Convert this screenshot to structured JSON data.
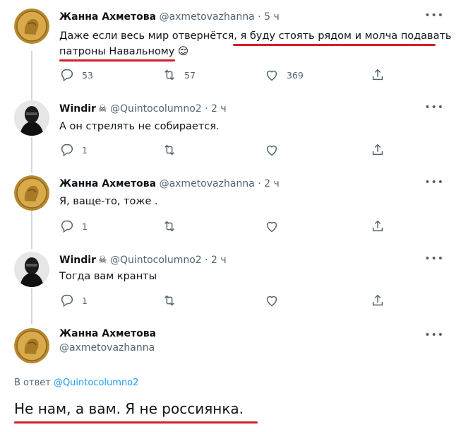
{
  "tweets": [
    {
      "name": "Жанна Ахметова",
      "handle": "@axmetovazhanna",
      "sep": "·",
      "time": "5 ч",
      "text_line1_a": "Даже если весь мир отвернётся, ",
      "text_line1_b": "я буду стоять рядом и молча подавать",
      "text_line2": "патроны Навальному",
      "emoji": "😌",
      "replies": "53",
      "retweets": "57",
      "likes": "369"
    },
    {
      "name": "Windir",
      "badge": "☠",
      "handle": "@Quintocolumno2",
      "sep": "·",
      "time": "2 ч",
      "text": "А он стрелять не собирается.",
      "replies": "1"
    },
    {
      "name": "Жанна Ахметова",
      "handle": "@axmetovazhanna",
      "sep": "·",
      "time": "2 ч",
      "text": "Я, ваще-то, тоже .",
      "replies": "1"
    },
    {
      "name": "Windir",
      "badge": "☠",
      "handle": "@Quintocolumno2",
      "sep": "·",
      "time": "2 ч",
      "text": "Тогда вам кранты",
      "replies": "1"
    }
  ],
  "main_tweet": {
    "name": "Жанна Ахметова",
    "handle": "@axmetovazhanna",
    "reply_prefix": "В ответ ",
    "reply_mention": "@Quintocolumno2",
    "text": "Не нам, а вам. Я не россиянка."
  },
  "more_label": "•••",
  "icons": [
    "reply-icon",
    "retweet-icon",
    "like-icon",
    "share-icon",
    "more-icon"
  ],
  "colors": {
    "accent": "#1d9bf0",
    "underline": "#d31d2a",
    "secondary": "#536471",
    "thread_line": "#cfd9de"
  }
}
